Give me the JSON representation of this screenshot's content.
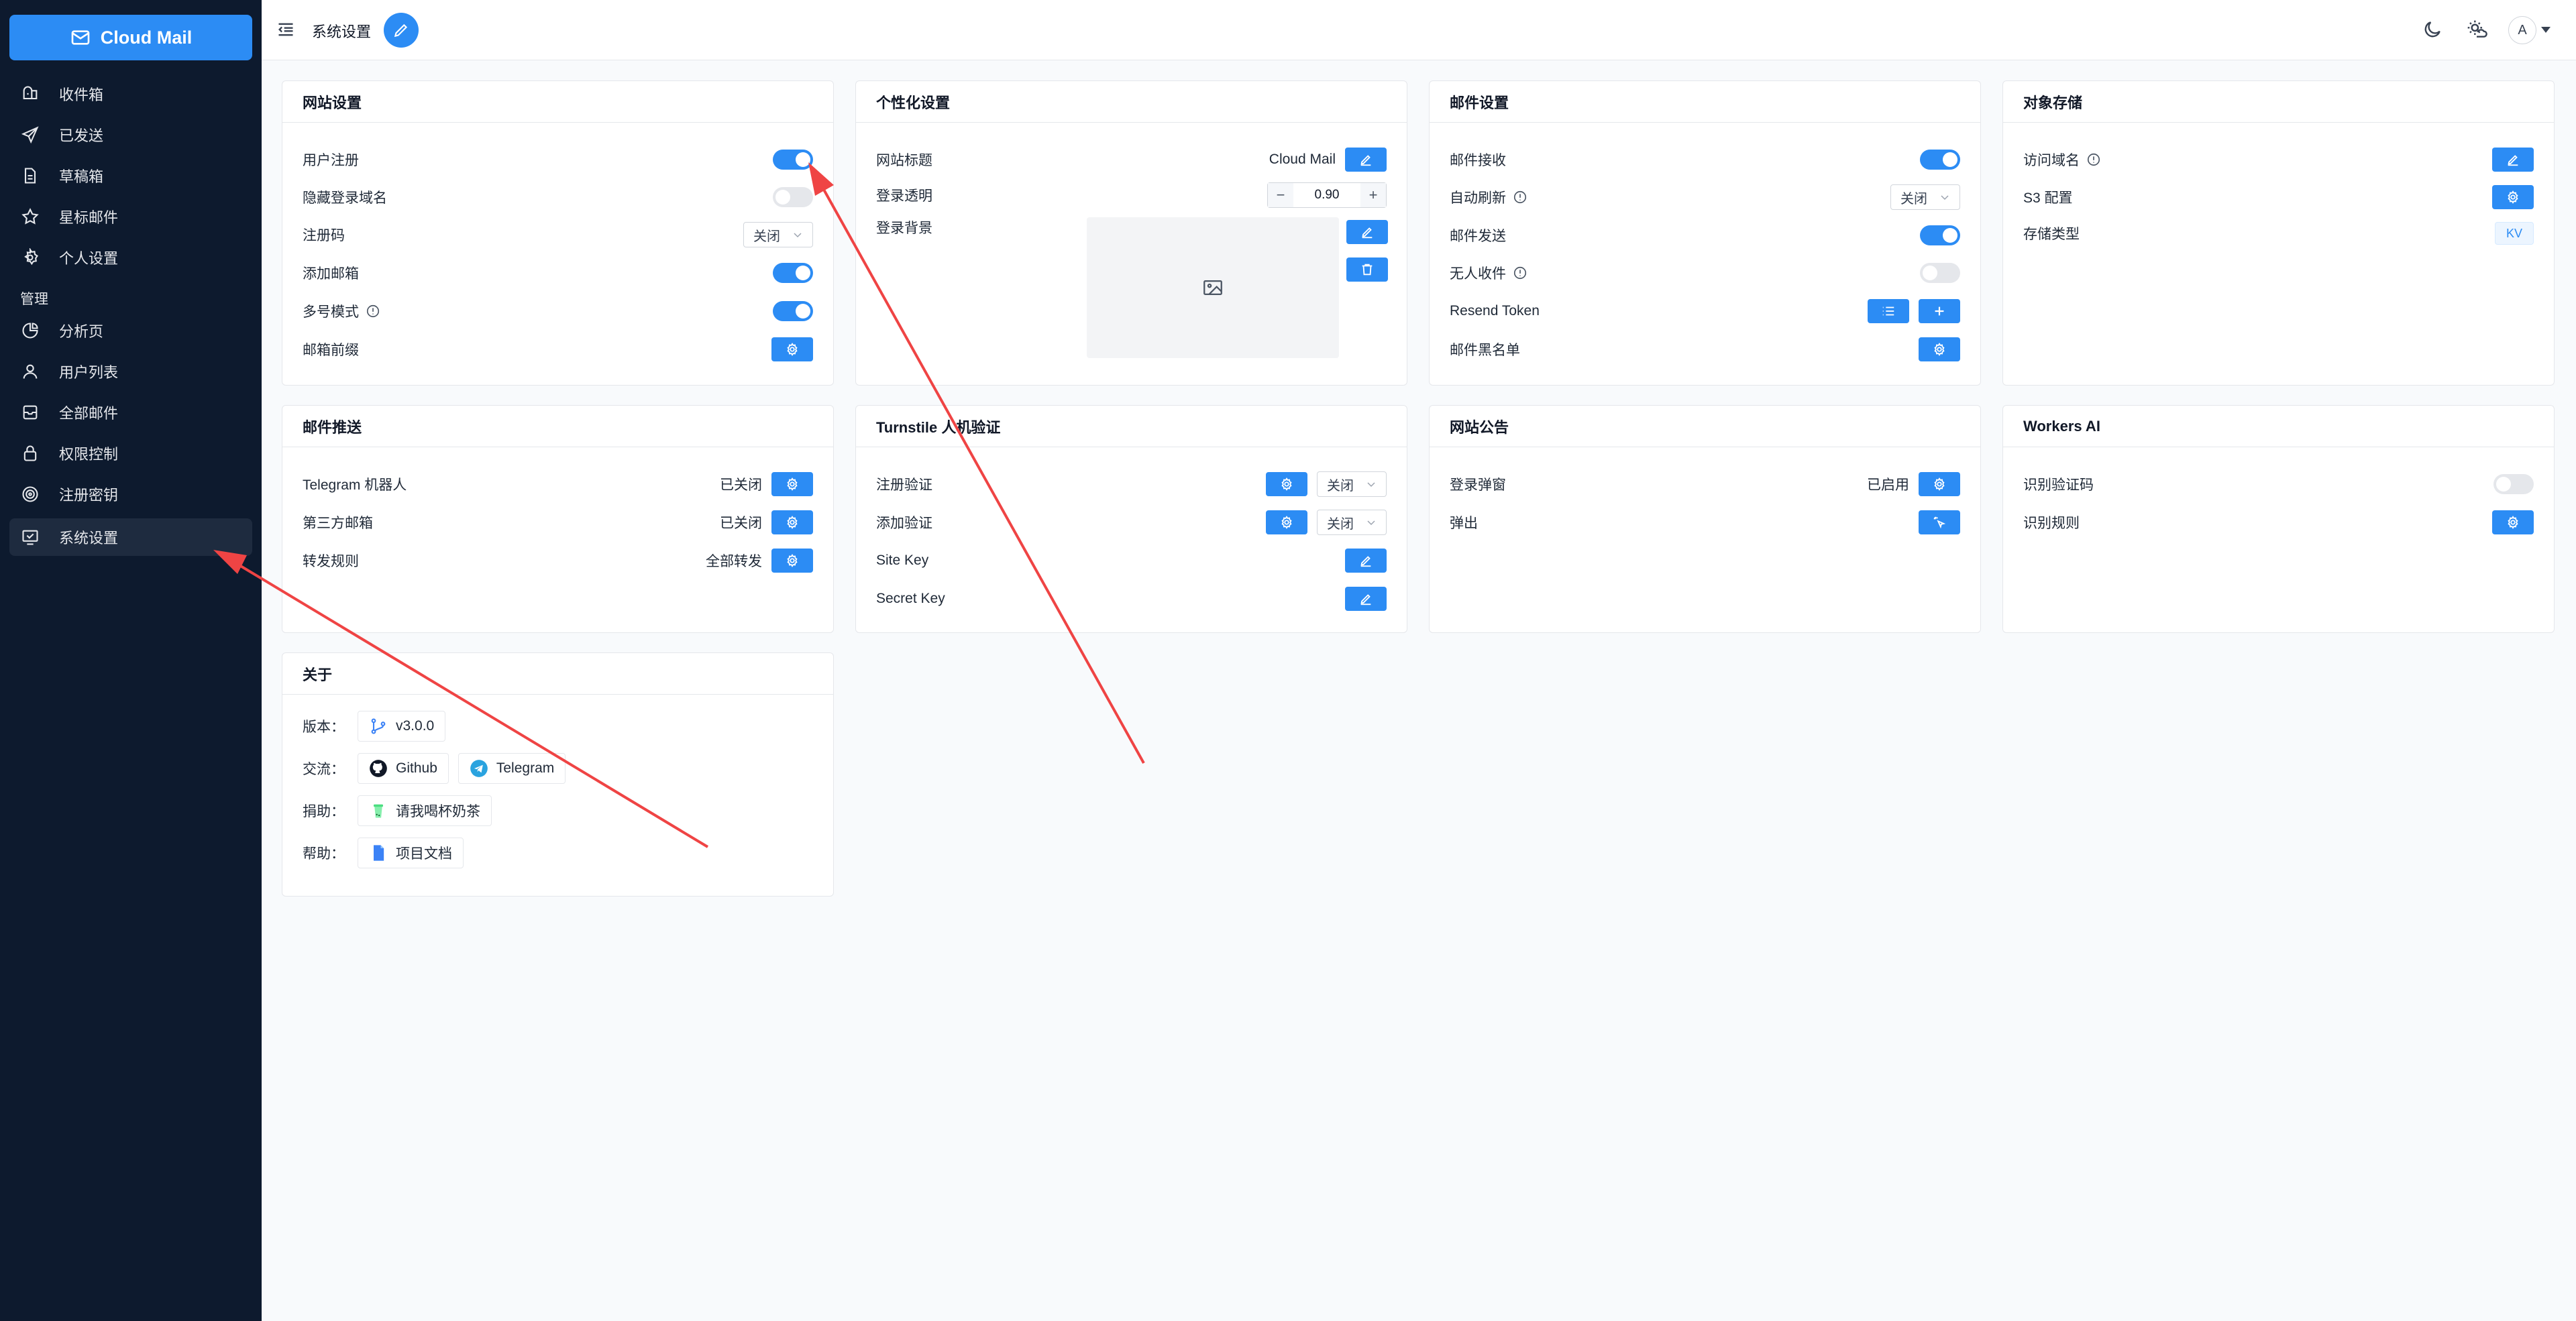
{
  "brand": "Cloud Mail",
  "nav": {
    "items": [
      "收件箱",
      "已发送",
      "草稿箱",
      "星标邮件",
      "个人设置"
    ],
    "section": "管理",
    "admin_items": [
      "分析页",
      "用户列表",
      "全部邮件",
      "权限控制",
      "注册密钥",
      "系统设置"
    ]
  },
  "header": {
    "title": "系统设置",
    "avatar": "A"
  },
  "site": {
    "title": "网站设置",
    "user_register": "用户注册",
    "hide_domain": "隐藏登录域名",
    "reg_code": "注册码",
    "reg_code_value": "关闭",
    "add_mailbox": "添加邮箱",
    "multi_mode": "多号模式",
    "mailbox_prefix": "邮箱前缀"
  },
  "personal": {
    "title": "个性化设置",
    "site_title": "网站标题",
    "site_title_value": "Cloud Mail",
    "login_opacity": "登录透明",
    "opacity_value": "0.90",
    "login_bg": "登录背景"
  },
  "mail": {
    "title": "邮件设置",
    "receive": "邮件接收",
    "auto_refresh": "自动刷新",
    "auto_refresh_value": "关闭",
    "send": "邮件发送",
    "no_recipient": "无人收件",
    "resend_token": "Resend Token",
    "blacklist": "邮件黑名单"
  },
  "storage": {
    "title": "对象存储",
    "access_domain": "访问域名",
    "s3_config": "S3 配置",
    "storage_type": "存储类型",
    "storage_type_value": "KV"
  },
  "push": {
    "title": "邮件推送",
    "telegram": "Telegram 机器人",
    "telegram_status": "已关闭",
    "third_party": "第三方邮箱",
    "third_party_status": "已关闭",
    "forward_rule": "转发规则",
    "forward_status": "全部转发"
  },
  "turnstile": {
    "title": "Turnstile 人机验证",
    "reg_verify": "注册验证",
    "reg_verify_value": "关闭",
    "add_verify": "添加验证",
    "add_verify_value": "关闭",
    "site_key": "Site Key",
    "secret_key": "Secret Key"
  },
  "notice": {
    "title": "网站公告",
    "login_popup": "登录弹窗",
    "login_popup_status": "已启用",
    "popup": "弹出"
  },
  "ai": {
    "title": "Workers AI",
    "recognize_code": "识别验证码",
    "recognize_rule": "识别规则"
  },
  "about": {
    "title": "关于",
    "version_label": "版本：",
    "version": "v3.0.0",
    "community_label": "交流：",
    "github": "Github",
    "telegram": "Telegram",
    "donate_label": "捐助：",
    "donate": "请我喝杯奶茶",
    "help_label": "帮助：",
    "docs": "项目文档"
  },
  "colors": {
    "accent": "#2c8cf4",
    "sidebar": "#0d1a2e",
    "arrow": "#ef4444"
  }
}
